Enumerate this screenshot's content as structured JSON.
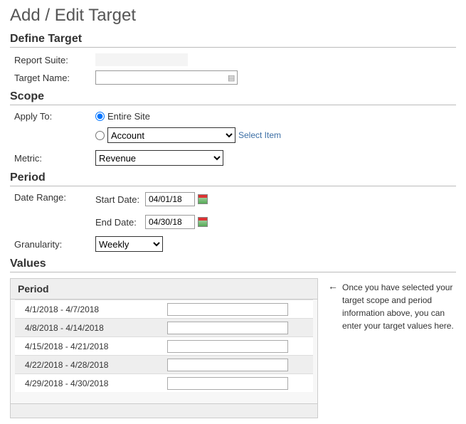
{
  "page": {
    "title": "Add / Edit Target"
  },
  "define": {
    "heading": "Define Target",
    "report_suite_label": "Report Suite:",
    "report_suite_value": "",
    "target_name_label": "Target Name:",
    "target_name_value": ""
  },
  "scope": {
    "heading": "Scope",
    "apply_to_label": "Apply To:",
    "entire_site_label": "Entire Site",
    "entire_site_selected": true,
    "account_options": [
      "Account"
    ],
    "account_selected": "Account",
    "select_item_link": "Select Item",
    "metric_label": "Metric:",
    "metric_options": [
      "Revenue"
    ],
    "metric_selected": "Revenue"
  },
  "period": {
    "heading": "Period",
    "date_range_label": "Date Range:",
    "start_date_label": "Start Date:",
    "start_date_value": "04/01/18",
    "end_date_label": "End Date:",
    "end_date_value": "04/30/18",
    "granularity_label": "Granularity:",
    "granularity_options": [
      "Weekly"
    ],
    "granularity_selected": "Weekly"
  },
  "values": {
    "heading": "Values",
    "period_col_header": "Period",
    "rows": [
      {
        "period": "4/1/2018 - 4/7/2018",
        "value": ""
      },
      {
        "period": "4/8/2018 - 4/14/2018",
        "value": ""
      },
      {
        "period": "4/15/2018 - 4/21/2018",
        "value": ""
      },
      {
        "period": "4/22/2018 - 4/28/2018",
        "value": ""
      },
      {
        "period": "4/29/2018 - 4/30/2018",
        "value": ""
      }
    ],
    "hint": "Once you have selected your target scope and period information above, you can enter your target values here."
  }
}
